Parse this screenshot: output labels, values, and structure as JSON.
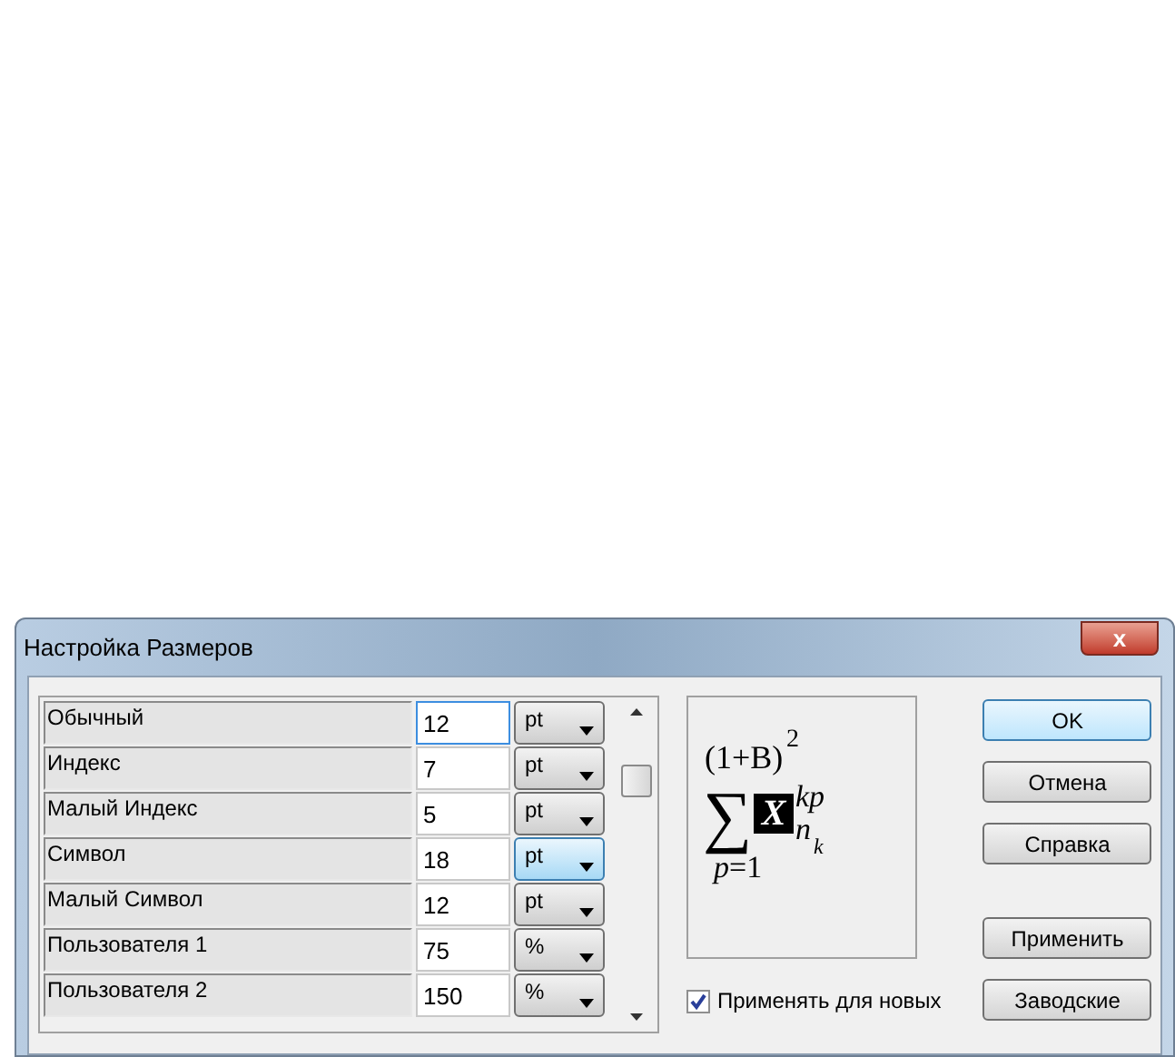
{
  "window": {
    "title": "Настройка Размеров",
    "close": "x"
  },
  "sizes": [
    {
      "label": "Обычный",
      "value": "12",
      "unit": "pt",
      "value_focused": true,
      "unit_focused": false
    },
    {
      "label": "Индекс",
      "value": "7",
      "unit": "pt",
      "value_focused": false,
      "unit_focused": false
    },
    {
      "label": "Малый Индекс",
      "value": "5",
      "unit": "pt",
      "value_focused": false,
      "unit_focused": false
    },
    {
      "label": "Символ",
      "value": "18",
      "unit": "pt",
      "value_focused": false,
      "unit_focused": true
    },
    {
      "label": "Малый Символ",
      "value": "12",
      "unit": "pt",
      "value_focused": false,
      "unit_focused": false
    },
    {
      "label": "Пользователя 1",
      "value": "75",
      "unit": "%",
      "value_focused": false,
      "unit_focused": false
    },
    {
      "label": "Пользователя 2",
      "value": "150",
      "unit": "%",
      "value_focused": false,
      "unit_focused": false
    }
  ],
  "preview": {
    "base": "(1+B)",
    "power": "2",
    "sum": "∑",
    "symbol": "X",
    "sup": "kp",
    "sub": "n",
    "subsub": "k",
    "limit": "p=1"
  },
  "apply_to_new": {
    "label": "Применять для новых",
    "checked": true
  },
  "buttons": [
    {
      "label": "OK",
      "default": true
    },
    {
      "label": "Отмена",
      "default": false
    },
    {
      "label": "Справка",
      "default": false
    }
  ],
  "lower_buttons": [
    {
      "label": "Применить",
      "default": false
    },
    {
      "label": "Заводские",
      "default": false
    }
  ]
}
